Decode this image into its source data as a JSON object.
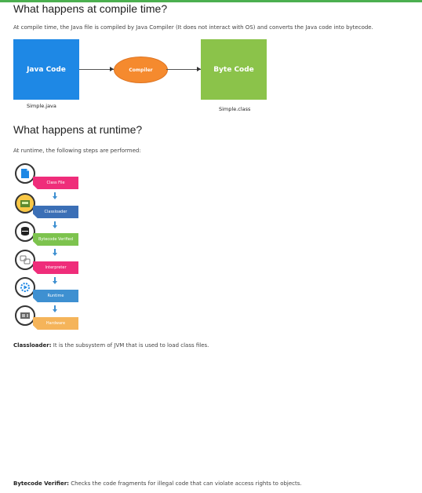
{
  "compile": {
    "heading": "What happens at compile time?",
    "description": "At compile time, the Java file is compiled by Java Compiler (It does not interact with OS) and converts the Java code into bytecode.",
    "source_box": {
      "label": "Java Code",
      "caption": "Simple.java",
      "color": "#1e88e5"
    },
    "compiler": {
      "label": "Compiler",
      "color": "#f58a2e"
    },
    "target_box": {
      "label": "Byte Code",
      "caption": "Simple.class",
      "color": "#8bc34a"
    }
  },
  "runtime": {
    "heading": "What happens at runtime?",
    "description": "At runtime, the following steps are performed:",
    "steps": [
      {
        "label": "Class File",
        "color": "#ef2d7a",
        "icon": "file-icon"
      },
      {
        "label": "Classloader",
        "color": "#3b6fb6",
        "icon": "folder-icon"
      },
      {
        "label": "Bytecode Verified",
        "color": "#7dc34e",
        "icon": "database-icon"
      },
      {
        "label": "Interpreter",
        "color": "#ef2d7a",
        "icon": "translate-icon"
      },
      {
        "label": "Runtime",
        "color": "#3e90d1",
        "icon": "gear-play-icon"
      },
      {
        "label": "Hardware",
        "color": "#f5b45a",
        "icon": "hardware-icon"
      }
    ]
  },
  "definitions": [
    {
      "term": "Classloader:",
      "text": "It is the subsystem of JVM that is used to load class files."
    },
    {
      "term": "Bytecode Verifier:",
      "text": "Checks the code fragments for illegal code that can violate access rights to objects."
    }
  ]
}
